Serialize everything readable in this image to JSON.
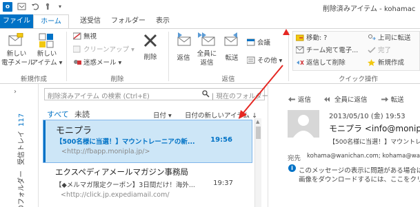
{
  "window": {
    "title": "削除済みアイテム - kohamac"
  },
  "tabs": {
    "file": "ファイル",
    "home": "ホーム",
    "send_receive": "送受信",
    "folder": "フォルダー",
    "view": "表示"
  },
  "ribbon": {
    "new_group": {
      "new_email_line1": "新しい",
      "new_email_line2": "電子メール",
      "new_items_line1": "新しい",
      "new_items_line2": "アイテム",
      "label": "新規作成"
    },
    "delete_group": {
      "ignore": "無視",
      "cleanup": "クリーンアップ",
      "junk": "迷惑メール",
      "delete": "削除",
      "label": "削除"
    },
    "respond_group": {
      "reply": "返信",
      "reply_all_line1": "全員に",
      "reply_all_line2": "返信",
      "forward": "転送",
      "meeting": "会議",
      "more": "その他",
      "label": "返信"
    },
    "quick_steps_group": {
      "move": "移動: ?",
      "team_email": "チーム宛て電子...",
      "reply_delete": "返信して削除",
      "to_manager": "上司に転送",
      "done": "完了",
      "create_new": "新規作成",
      "label": "クイック操作"
    }
  },
  "nav": {
    "inbox_label": "受信トレイ",
    "inbox_count": "117",
    "folder_label": "のフォルダー"
  },
  "message_list": {
    "search_placeholder": "削除済みアイテム の検索 (Ctrl+E)",
    "search_scope": "現在のフォルダー",
    "filter_all": "すべて",
    "filter_unread": "未読",
    "sort_by": "日付",
    "sort_order": "日付の新しいアイテム",
    "messages": [
      {
        "sender": "モニプラ",
        "subject": "【500名様に当選！】マウントレーニアの新...",
        "time": "19:56",
        "preview": "<http://fbapp.moniplа.jp/>"
      },
      {
        "sender": "エクスペディアメールマガジン事務局",
        "subject": "【◆メルマガ限定クーポン】3日間だけ！海外...",
        "time": "19:37",
        "preview": "<http://click.jp.expediamail.com/"
      }
    ]
  },
  "reading_pane": {
    "reply": "返信",
    "reply_all": "全員に返信",
    "forward": "転送",
    "date": "2013/05/10 (金) 19:53",
    "from": "モニプラ <info@monipl",
    "subject": "【500名様に当選！】マウントレ",
    "to_label": "宛先",
    "to": "kohama@wanichan.com; kohama@wa",
    "info_line1": "このメッセージの表示に問題がある場合は、",
    "info_line2": "画像をダウンロードするには、ここをクリックしま"
  }
}
